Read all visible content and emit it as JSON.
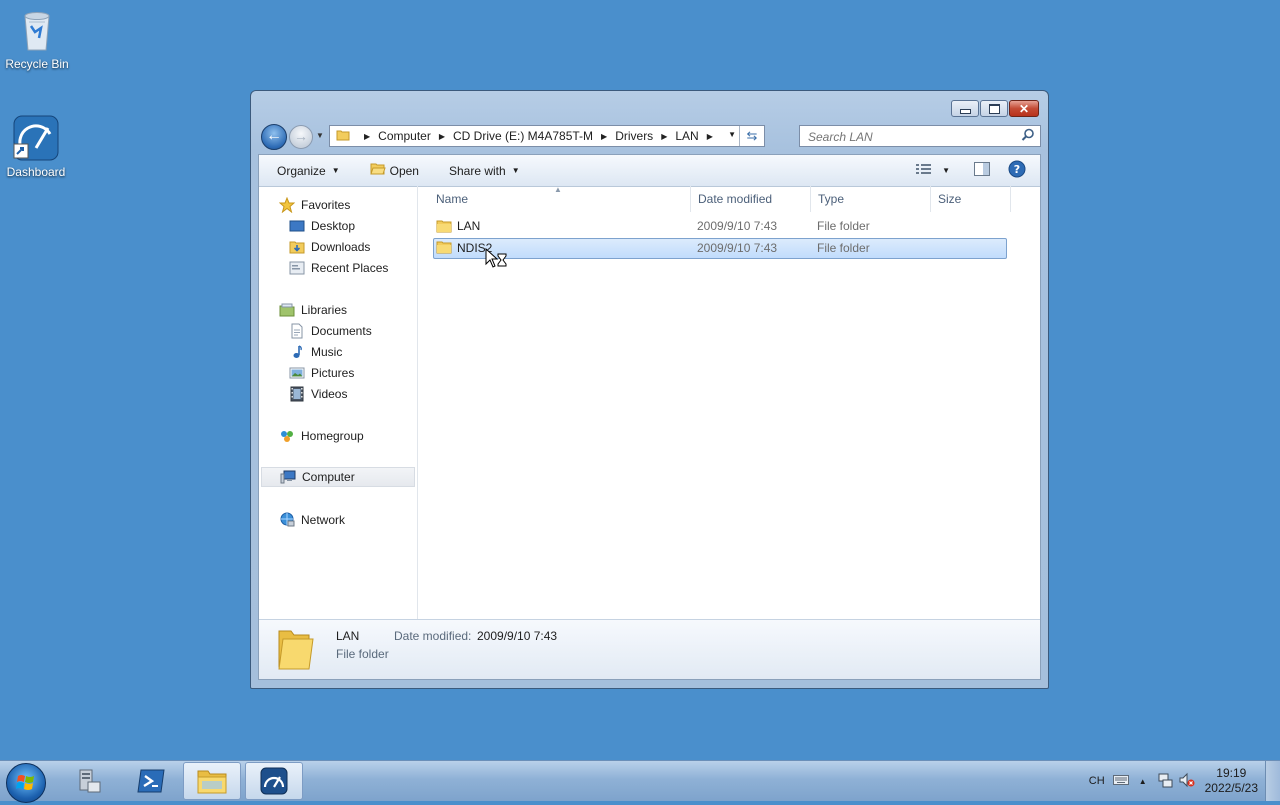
{
  "desktop": {
    "icons": [
      {
        "label": "Recycle Bin",
        "icon": "recycle-bin-icon"
      },
      {
        "label": "Dashboard",
        "icon": "dashboard-icon"
      }
    ]
  },
  "window": {
    "address": {
      "crumbs": [
        "Computer",
        "CD Drive (E:) M4A785T-M",
        "Drivers",
        "LAN"
      ]
    },
    "search": {
      "placeholder": "Search LAN"
    },
    "toolbar": {
      "organize": "Organize",
      "open": "Open",
      "share_with": "Share with"
    },
    "nav": {
      "favorites": "Favorites",
      "desktop": "Desktop",
      "downloads": "Downloads",
      "recent_places": "Recent Places",
      "libraries": "Libraries",
      "documents": "Documents",
      "music": "Music",
      "pictures": "Pictures",
      "videos": "Videos",
      "homegroup": "Homegroup",
      "computer": "Computer",
      "network": "Network"
    },
    "columns": {
      "name": "Name",
      "date_modified": "Date modified",
      "type": "Type",
      "size": "Size"
    },
    "files": [
      {
        "name": "LAN",
        "date": "2009/9/10 7:43",
        "type": "File folder",
        "selected": false
      },
      {
        "name": "NDIS2",
        "date": "2009/9/10 7:43",
        "type": "File folder",
        "selected": true
      }
    ],
    "details": {
      "name": "LAN",
      "date_label": "Date modified:",
      "date_value": "2009/9/10 7:43",
      "type": "File folder"
    }
  },
  "taskbar": {
    "language": "CH",
    "time": "19:19",
    "date": "2022/5/23"
  },
  "colors": {
    "desktop": "#4a8fcc",
    "selection": "#c1dcfc",
    "accent": "#2d6bb5"
  }
}
